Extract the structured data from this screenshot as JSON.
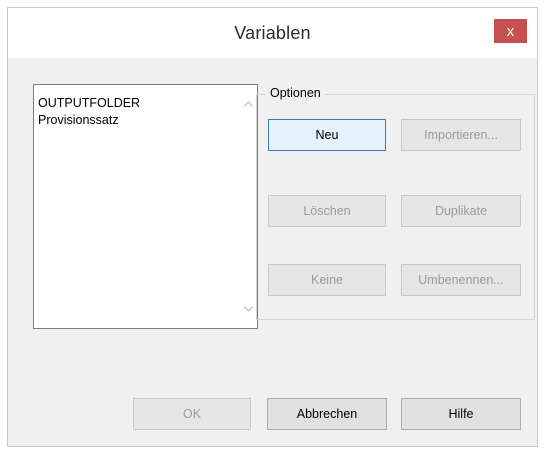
{
  "window": {
    "title": "Variablen",
    "close_label": "x"
  },
  "variables": {
    "items": [
      "OUTPUTFOLDER",
      "Provisionssatz"
    ]
  },
  "options": {
    "label": "Optionen",
    "buttons": {
      "new": "Neu",
      "import": "Importieren...",
      "delete": "Löschen",
      "duplicates": "Duplikate",
      "none": "Keine",
      "rename": "Umbenennen..."
    }
  },
  "footer": {
    "ok": "OK",
    "cancel": "Abbrechen",
    "help": "Hilfe"
  },
  "colors": {
    "close_button": "#c75050",
    "focus_border": "#3c7fb1"
  }
}
